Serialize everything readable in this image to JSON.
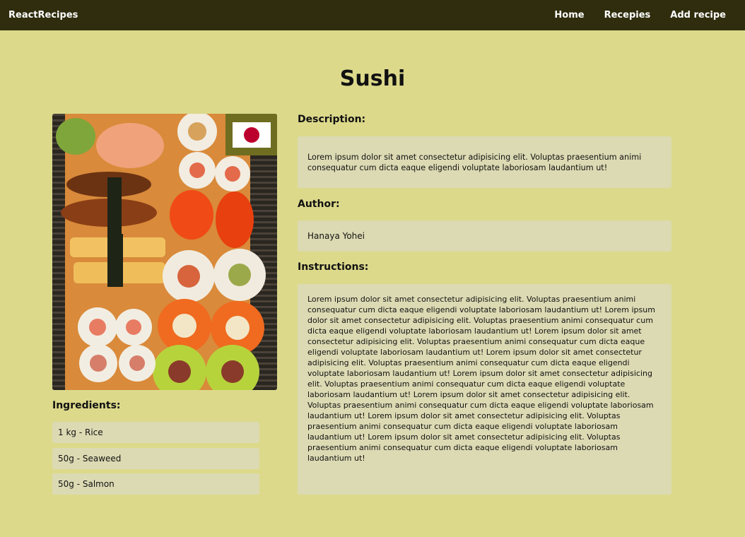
{
  "navbar": {
    "brand": "ReactRecipes",
    "links": [
      "Home",
      "Recepies",
      "Add recipe"
    ]
  },
  "recipe": {
    "title": "Sushi",
    "image_alt": "sushi",
    "flag": "japan-flag",
    "ingredients_label": "Ingredients:",
    "ingredients": [
      "1 kg - Rice",
      "50g - Seaweed",
      "50g - Salmon"
    ],
    "description_label": "Description:",
    "description": "Lorem ipsum dolor sit amet consectetur adipisicing elit. Voluptas praesentium animi consequatur cum dicta eaque eligendi voluptate laboriosam laudantium ut!",
    "author_label": "Author:",
    "author": "Hanaya Yohei",
    "instructions_label": "Instructions:",
    "instructions": "Lorem ipsum dolor sit amet consectetur adipisicing elit. Voluptas praesentium animi consequatur cum dicta eaque eligendi voluptate laboriosam laudantium ut! Lorem ipsum dolor sit amet consectetur adipisicing elit. Voluptas praesentium animi consequatur cum dicta eaque eligendi voluptate laboriosam laudantium ut! Lorem ipsum dolor sit amet consectetur adipisicing elit. Voluptas praesentium animi consequatur cum dicta eaque eligendi voluptate laboriosam laudantium ut! Lorem ipsum dolor sit amet consectetur adipisicing elit. Voluptas praesentium animi consequatur cum dicta eaque eligendi voluptate laboriosam laudantium ut! Lorem ipsum dolor sit amet consectetur adipisicing elit. Voluptas praesentium animi consequatur cum dicta eaque eligendi voluptate laboriosam laudantium ut! Lorem ipsum dolor sit amet consectetur adipisicing elit. Voluptas praesentium animi consequatur cum dicta eaque eligendi voluptate laboriosam laudantium ut! Lorem ipsum dolor sit amet consectetur adipisicing elit. Voluptas praesentium animi consequatur cum dicta eaque eligendi voluptate laboriosam laudantium ut! Lorem ipsum dolor sit amet consectetur adipisicing elit. Voluptas praesentium animi consequatur cum dicta eaque eligendi voluptate laboriosam laudantium ut!"
  },
  "colors": {
    "background": "#dcd98b",
    "navbar": "#2f2d0d",
    "panel": "#dcdab3",
    "flag_frame": "#6f6e20",
    "flag_red": "#bc002d"
  }
}
